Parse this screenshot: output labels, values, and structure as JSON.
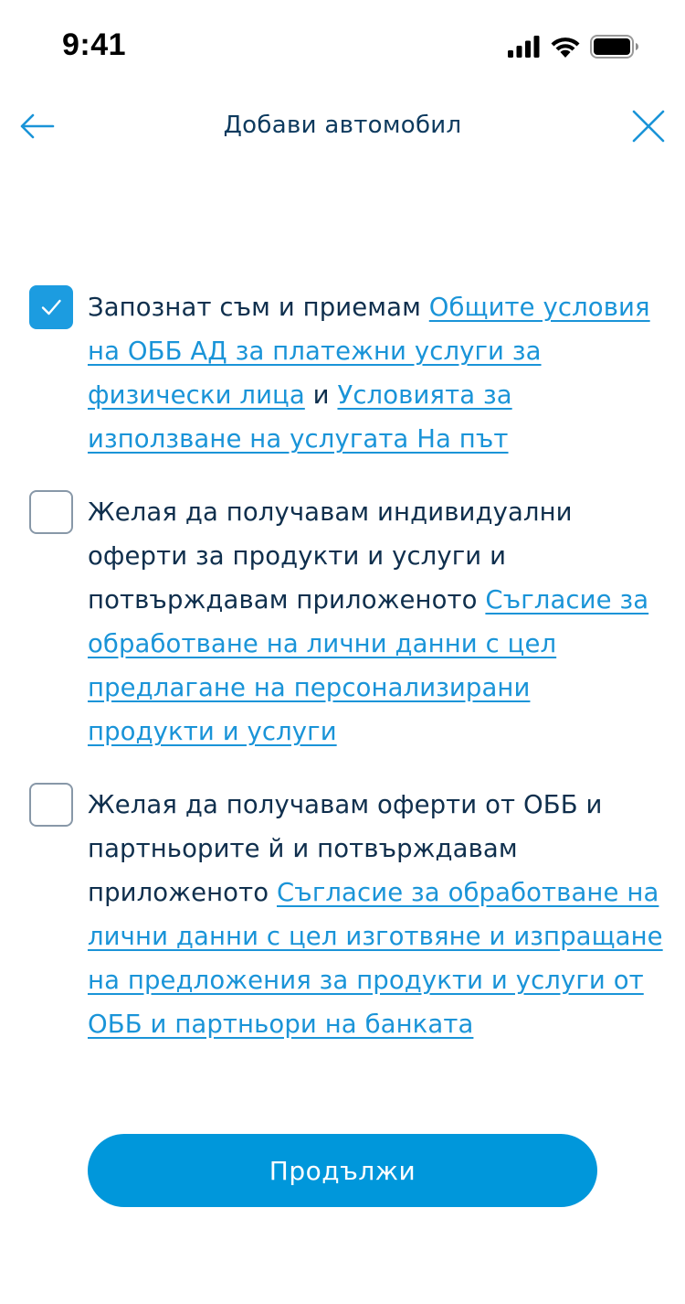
{
  "status_bar": {
    "time": "9:41"
  },
  "header": {
    "title": "Добави автомобил",
    "back_icon": "arrow-left-icon",
    "close_icon": "close-icon"
  },
  "consents": [
    {
      "checked": true,
      "text_before": "Запознат съм и приемам ",
      "link1": "Общите условия на ОББ АД за платежни услуги за физически лица",
      "connector": " и ",
      "link2": "Условията за използване на услугата На път"
    },
    {
      "checked": false,
      "text_before": "Желая да получавам индивидуални оферти за продукти и услуги и потвърждавам приложеното ",
      "link1": "Съгласие за обработване на лични данни с цел предлагане на персонализирани продукти и услуги"
    },
    {
      "checked": false,
      "text_before": "Желая да получавам оферти от ОББ и партньорите й и потвърждавам приложеното ",
      "link1": "Съгласие за обработване на лични данни с цел изготвяне и изпращане на предложения за продукти и услуги от ОББ и партньори на банката"
    }
  ],
  "actions": {
    "continue_label": "Продължи"
  },
  "colors": {
    "accent": "#0097db",
    "link": "#1a94d8",
    "text": "#0f2f4d"
  }
}
